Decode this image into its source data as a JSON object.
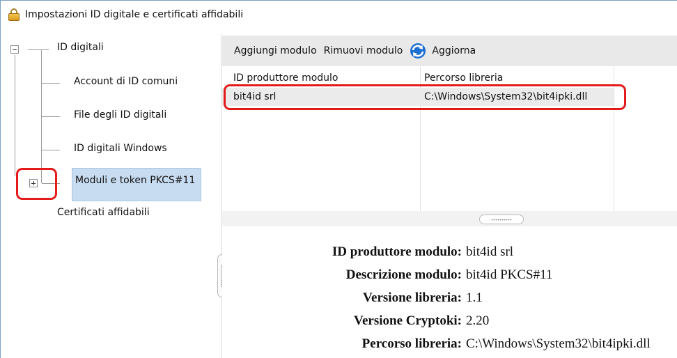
{
  "window": {
    "title": "Impostazioni ID digitale e certificati affidabili"
  },
  "tree": {
    "root_label": "ID digitali",
    "children": [
      {
        "label": "Account di ID comuni"
      },
      {
        "label": "File degli ID digitali"
      },
      {
        "label": "ID digitali Windows"
      },
      {
        "label": "Moduli e token PKCS#11"
      }
    ],
    "second_root_label": "Certificati affidabili"
  },
  "toolbar": {
    "add_label": "Aggiungi modulo",
    "remove_label": "Rimuovi modulo",
    "refresh_label": "Aggiorna"
  },
  "table": {
    "columns": [
      "ID produttore modulo",
      "Percorso libreria"
    ],
    "rows": [
      {
        "manufacturer": "bit4id srl",
        "path": "C:\\Windows\\System32\\bit4ipki.dll"
      }
    ]
  },
  "details": [
    {
      "key": "ID produttore modulo:",
      "value": "bit4id srl"
    },
    {
      "key": "Descrizione modulo:",
      "value": "bit4id PKCS#11"
    },
    {
      "key": "Versione libreria:",
      "value": "1.1"
    },
    {
      "key": "Versione Cryptoki:",
      "value": "2.20"
    },
    {
      "key": "Percorso libreria:",
      "value": "C:\\Windows\\System32\\bit4ipki.dll"
    }
  ],
  "colors": {
    "highlight": "#e31b1b",
    "selection": "#c7dcf1",
    "toolbar_bg": "#e9e9e9"
  }
}
